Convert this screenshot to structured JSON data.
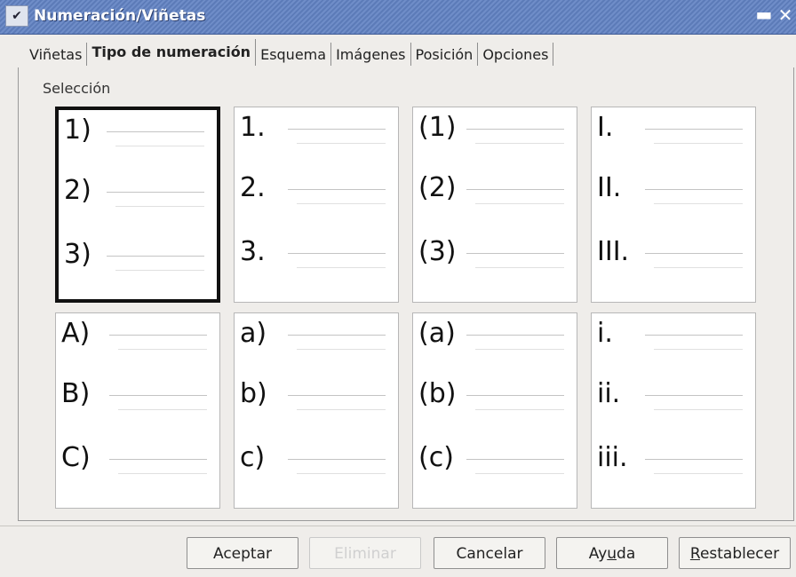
{
  "window": {
    "title": "Numeración/Viñetas",
    "menu_glyph": "✔",
    "minimize_glyph": "▬",
    "close_glyph": "✕"
  },
  "tabs": [
    {
      "label": "Viñetas",
      "active": false
    },
    {
      "label": "Tipo de numeración",
      "active": true
    },
    {
      "label": "Esquema",
      "active": false
    },
    {
      "label": "Imágenes",
      "active": false
    },
    {
      "label": "Posición",
      "active": false
    },
    {
      "label": "Opciones",
      "active": false
    }
  ],
  "section_label": "Selección",
  "options": [
    {
      "labels": [
        "1)",
        "2)",
        "3)"
      ],
      "selected": true
    },
    {
      "labels": [
        "1.",
        "2.",
        "3."
      ],
      "selected": false
    },
    {
      "labels": [
        "(1)",
        "(2)",
        "(3)"
      ],
      "selected": false
    },
    {
      "labels": [
        "I.",
        "II.",
        "III."
      ],
      "selected": false
    },
    {
      "labels": [
        "A)",
        "B)",
        "C)"
      ],
      "selected": false
    },
    {
      "labels": [
        "a)",
        "b)",
        "c)"
      ],
      "selected": false
    },
    {
      "labels": [
        "(a)",
        "(b)",
        "(c)"
      ],
      "selected": false
    },
    {
      "labels": [
        "i.",
        "ii.",
        "iii."
      ],
      "selected": false
    }
  ],
  "buttons": {
    "ok": "Aceptar",
    "remove": "Eliminar",
    "cancel": "Cancelar",
    "help": {
      "before": "Ay",
      "mnemonic": "u",
      "after": "da"
    },
    "reset": {
      "before": "",
      "mnemonic": "R",
      "after": "establecer"
    }
  }
}
